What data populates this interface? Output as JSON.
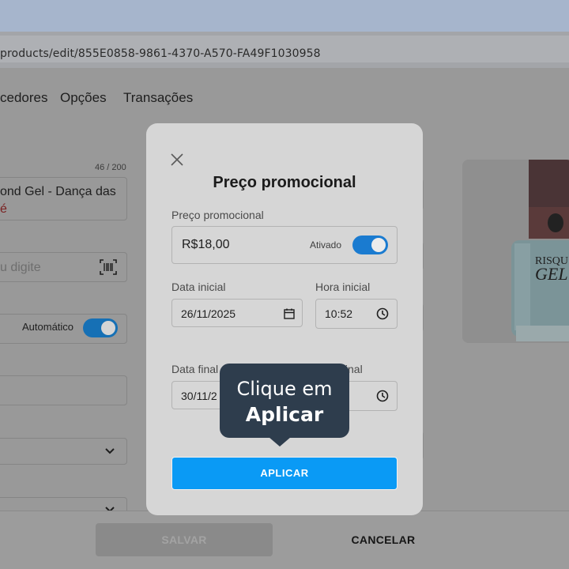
{
  "browser": {
    "url": "products/edit/855E0858-9861-4370-A570-FA49F1030958"
  },
  "nav": {
    "tabs": [
      "cedores",
      "Opções",
      "Transações"
    ]
  },
  "form": {
    "char_counter": "46 / 200",
    "product_name": "ond Gel - Dança das",
    "product_name_line2": "é",
    "barcode_placeholder": "u digite",
    "auto_label": "Automático"
  },
  "footer": {
    "save_label": "SALVAR",
    "cancel_label": "CANCELAR"
  },
  "modal": {
    "title": "Preço promocional",
    "price_label": "Preço promocional",
    "price_value": "R$18,00",
    "status_label": "Ativado",
    "start_date_label": "Data inicial",
    "start_date_value": "26/11/2025",
    "start_time_label": "Hora inicial",
    "start_time_value": "10:52",
    "end_date_label": "Data final",
    "end_date_value": "30/11/2",
    "end_time_label": "final",
    "apply_label": "APLICAR"
  },
  "tooltip": {
    "line1": "Clique em",
    "line2": "Aplicar"
  },
  "colors": {
    "accent": "#0a9af5",
    "toggle_on": "#1a7bd0",
    "tooltip_bg": "#2e3d4d"
  },
  "icons": [
    "close-icon",
    "calendar-icon",
    "clock-icon",
    "barcode-icon",
    "chevron-down-icon"
  ]
}
